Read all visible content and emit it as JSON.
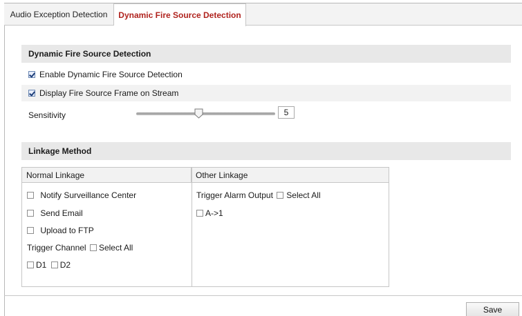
{
  "tabs": [
    {
      "label": "Audio Exception Detection",
      "active": false
    },
    {
      "label": "Dynamic Fire Source Detection",
      "active": true
    }
  ],
  "detection": {
    "header": "Dynamic Fire Source Detection",
    "enable_label": "Enable Dynamic Fire Source Detection",
    "enable_checked": true,
    "display_label": "Display Fire Source Frame on Stream",
    "display_checked": true,
    "sensitivity_label": "Sensitivity",
    "sensitivity_value": "5"
  },
  "linkage": {
    "header": "Linkage Method",
    "normal_header": "Normal Linkage",
    "other_header": "Other Linkage",
    "notify_label": "Notify Surveillance Center",
    "email_label": "Send Email",
    "ftp_label": "Upload to FTP",
    "trigger_channel_label": "Trigger Channel",
    "channel_select_all_label": "Select All",
    "channels": [
      "D1",
      "D2"
    ],
    "trigger_alarm_label": "Trigger Alarm Output",
    "alarm_select_all_label": "Select All",
    "alarm_outputs": [
      "A->1"
    ]
  },
  "footer": {
    "save_label": "Save"
  },
  "colors": {
    "active_tab_text": "#b0231e",
    "section_header_bg": "#e8e8e8"
  }
}
